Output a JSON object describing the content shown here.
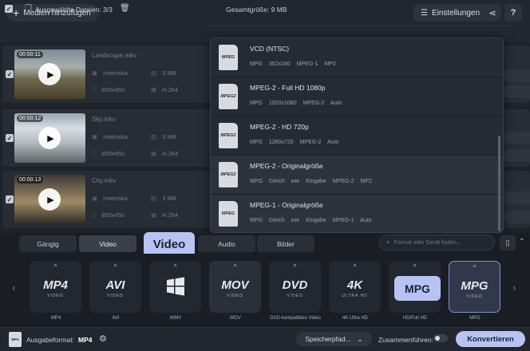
{
  "topbar": {
    "add_media_label": "Medien hinzufügen",
    "settings_label": "Einstellungen"
  },
  "selection": {
    "label": "Ausgewählte Dateien: 3/3",
    "total_size": "Gesamtgröße: 9 MB"
  },
  "files": [
    {
      "duration": "00:00:11",
      "name": "Landscape.mkv",
      "container": "matroska",
      "size": "3 MB",
      "resolution": "800x450",
      "codec": "H.264"
    },
    {
      "duration": "00:00:12",
      "name": "Sky.mkv",
      "container": "matroska",
      "size": "3 MB",
      "resolution": "800x450",
      "codec": "H.264"
    },
    {
      "duration": "00:00:13",
      "name": "City.mkv",
      "container": "matroska",
      "size": "3 MB",
      "resolution": "800x450",
      "codec": "H.264"
    }
  ],
  "presets": [
    {
      "icon": "MPEG",
      "name": "VCD (NTSC)",
      "details": "MPG   352x240   MPEG-1   MP2"
    },
    {
      "icon": "MPEG2",
      "name": "MPEG-2 - Full HD 1080p",
      "details": "MPG   1920x1080   MPEG-2   Auto"
    },
    {
      "icon": "MPEG2",
      "name": "MPEG-2 - HD 720p",
      "details": "MPG   1280x720   MPEG-2   Auto"
    },
    {
      "icon": "MPEG2",
      "name": "MPEG-2  - Originalgröße",
      "details": "MPG   Gleich wie Eingabe   MPEG-2   MP2"
    },
    {
      "icon": "MPEG",
      "name": "MPEG-1  - Originalgröße",
      "details": "MPG   Gleich wie Eingabe   MPEG-1   Auto"
    }
  ],
  "tabs": [
    "Gängig",
    "Video",
    "Audio",
    "Bilder"
  ],
  "video_tooltip": "Video",
  "search_placeholder": "Format oder Gerät finden...",
  "formats": [
    {
      "logo": "MP4",
      "sub": "VIDEO",
      "label": "MP4"
    },
    {
      "logo": "AVI",
      "sub": "VIDEO",
      "label": "AVI"
    },
    {
      "logo": "",
      "sub": "",
      "label": "WMV"
    },
    {
      "logo": "MOV",
      "sub": "VIDEO",
      "label": "MOV"
    },
    {
      "logo": "DVD",
      "sub": "VIDEO",
      "label": "DVD-kompatibles Video"
    },
    {
      "logo": "4K",
      "sub": "ULTRA HD",
      "label": "4K Ultra HD"
    },
    {
      "logo": "",
      "sub": "",
      "label": "HD/Full HD"
    },
    {
      "logo": "MPG",
      "sub": "VIDEO",
      "label": "MPG"
    }
  ],
  "mpg_tooltip": "MPG",
  "bottom": {
    "output_icon": "MP4",
    "output_label": "Ausgabeformat:",
    "output_value": "MP4",
    "save_label": "Speicherpfad...",
    "merge_label": "Zusammenführen:",
    "convert_label": "Konvertieren"
  },
  "colors": {
    "accent": "#b7c4f3",
    "background": "#1e2229",
    "panel": "#272c35"
  }
}
